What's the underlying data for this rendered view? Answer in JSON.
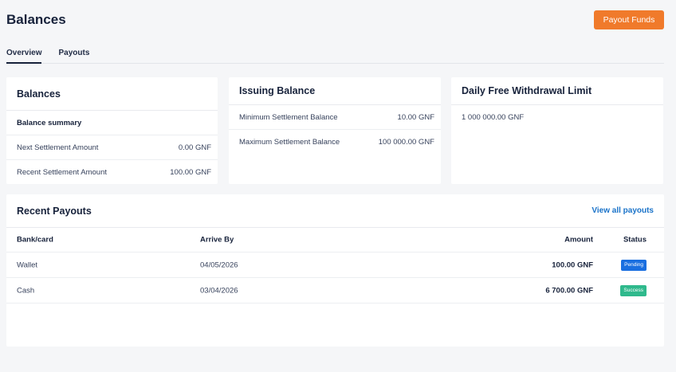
{
  "header": {
    "title": "Balances",
    "payout_button": "Payout Funds"
  },
  "tabs": [
    {
      "label": "Overview"
    },
    {
      "label": "Payouts"
    }
  ],
  "balances_card": {
    "title": "Balances",
    "summary_label": "Balance summary",
    "rows": [
      {
        "label": "Next Settlement Amount",
        "value": "0.00 GNF"
      },
      {
        "label": "Recent Settlement Amount",
        "value": "100.00 GNF"
      }
    ]
  },
  "issuing_card": {
    "title": "Issuing Balance",
    "rows": [
      {
        "label": "Minimum Settlement Balance",
        "value": "10.00 GNF"
      },
      {
        "label": "Maximum Settlement Balance",
        "value": "100 000.00 GNF"
      }
    ]
  },
  "withdrawal_card": {
    "title": "Daily Free Withdrawal Limit",
    "value": "1 000 000.00 GNF"
  },
  "recent_payouts": {
    "title": "Recent Payouts",
    "view_all": "View all payouts",
    "columns": {
      "bank": "Bank/card",
      "arrive": "Arrive By",
      "amount": "Amount",
      "status": "Status"
    },
    "rows": [
      {
        "bank": "Wallet",
        "arrive": "04/05/2026",
        "amount": "100.00 GNF",
        "status": "Pending"
      },
      {
        "bank": "Cash",
        "arrive": "03/04/2026",
        "amount": "6 700.00 GNF",
        "status": "Success"
      }
    ]
  },
  "colors": {
    "accent": "#f07a2b",
    "link": "#1a73c9",
    "pending": "#1a6fe0",
    "success": "#2fb98c"
  }
}
